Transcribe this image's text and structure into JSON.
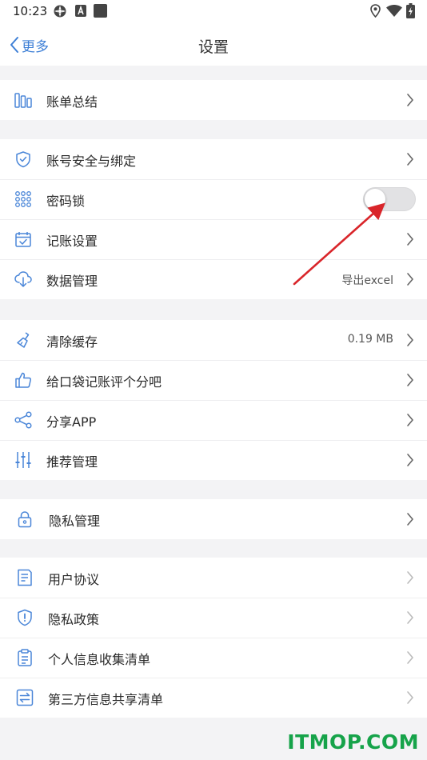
{
  "status_bar": {
    "time": "10:23",
    "icons": [
      "flower-notification-icon",
      "a-badge-icon",
      "square-notification-icon",
      "location-icon",
      "wifi-icon",
      "battery-charging-icon"
    ]
  },
  "nav": {
    "back_label": "更多",
    "title": "设置"
  },
  "groups": [
    {
      "items": [
        {
          "label": "账单总结",
          "icon": "bar-chart-icon",
          "control": "chevron"
        }
      ]
    },
    {
      "items": [
        {
          "label": "账号安全与绑定",
          "icon": "shield-check-icon",
          "control": "chevron"
        },
        {
          "label": "密码锁",
          "icon": "keypad-dots-icon",
          "control": "toggle",
          "enabled": false
        },
        {
          "label": "记账设置",
          "icon": "calendar-check-icon",
          "control": "chevron"
        },
        {
          "label": "数据管理",
          "icon": "cloud-download-icon",
          "control": "chevron",
          "value": "导出excel"
        }
      ]
    },
    {
      "items": [
        {
          "label": "清除缓存",
          "icon": "broom-icon",
          "control": "chevron",
          "value": "0.19 MB"
        },
        {
          "label": "给口袋记账评个分吧",
          "icon": "thumbs-up-icon",
          "control": "chevron"
        },
        {
          "label": "分享APP",
          "icon": "share-icon",
          "control": "chevron"
        },
        {
          "label": "推荐管理",
          "icon": "sliders-icon",
          "control": "chevron"
        }
      ]
    },
    {
      "items": [
        {
          "label": "隐私管理",
          "icon": "lock-icon",
          "control": "chevron"
        }
      ]
    },
    {
      "items": [
        {
          "label": "用户协议",
          "icon": "document-icon",
          "control": "chevron-light"
        },
        {
          "label": "隐私政策",
          "icon": "shield-alert-icon",
          "control": "chevron-light"
        },
        {
          "label": "个人信息收集清单",
          "icon": "clipboard-icon",
          "control": "chevron-light"
        },
        {
          "label": "第三方信息共享清单",
          "icon": "exchange-icon",
          "control": "chevron-light"
        }
      ]
    }
  ],
  "colors": {
    "accent": "#3d7fd6",
    "icon": "#4a86d8",
    "annotation_arrow": "#d9252a",
    "watermark": "#16a34a"
  },
  "watermark": "ITMOP.COM"
}
